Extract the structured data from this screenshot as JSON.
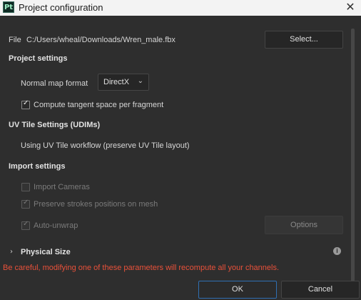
{
  "window": {
    "title": "Project configuration",
    "app_icon_text": "Pt"
  },
  "file": {
    "label": "File",
    "path": "C:/Users/wheal/Downloads/Wren_male.fbx",
    "select_button": "Select..."
  },
  "project_settings": {
    "heading": "Project settings",
    "normal_map_label": "Normal map format",
    "normal_map_value": "DirectX",
    "compute_tangent_label": "Compute tangent space per fragment",
    "compute_tangent_checked": true
  },
  "uv_tile": {
    "heading": "UV Tile Settings (UDIMs)",
    "workflow_text": "Using UV Tile workflow (preserve UV Tile layout)"
  },
  "import_settings": {
    "heading": "Import settings",
    "import_cameras_label": "Import Cameras",
    "import_cameras_checked": false,
    "preserve_strokes_label": "Preserve strokes positions on mesh",
    "preserve_strokes_checked": true,
    "auto_unwrap_label": "Auto-unwrap",
    "auto_unwrap_checked": true,
    "options_button": "Options"
  },
  "physical_size": {
    "heading": "Physical Size",
    "info_icon": "i"
  },
  "warning": "Be careful, modifying one of these parameters will recompute all your channels.",
  "footer": {
    "ok": "OK",
    "cancel": "Cancel"
  },
  "colors": {
    "background": "#2e2e2e",
    "warning": "#e9513a",
    "ok_border": "#2f6fb3"
  }
}
